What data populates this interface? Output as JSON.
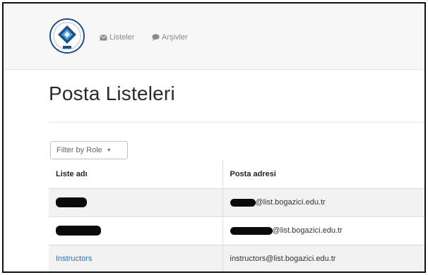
{
  "nav": {
    "listeler_label": "Listeler",
    "arsivler_label": "Arşivler"
  },
  "page": {
    "title": "Posta Listeleri"
  },
  "filter": {
    "label": "Filter by Role"
  },
  "table": {
    "headers": [
      "Liste adı",
      "Posta adresi"
    ],
    "rows": [
      {
        "name": "",
        "address": "@list.bogazici.edu.tr",
        "redacted": true
      },
      {
        "name": "",
        "address": "@list.bogazici.edu.tr",
        "redacted": true
      },
      {
        "name": "Instructors",
        "address": "instructors@list.bogazici.edu.tr",
        "redacted": false
      }
    ]
  },
  "colors": {
    "link": "#2f6fb1",
    "navbar_bg": "#f7f7f7",
    "row_alt_bg": "#f2f2f2"
  },
  "icons": {
    "logo": "university-seal-logo",
    "listeler": "envelope-icon",
    "arsivler": "speech-bubble-icon",
    "filter": "caret-down-icon"
  }
}
